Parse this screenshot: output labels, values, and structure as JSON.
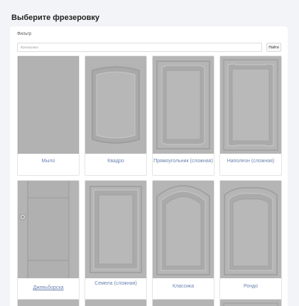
{
  "title": "Выберите фрезеровку",
  "filter": {
    "label": "Фильтр",
    "placeholder": "Фрезеровка",
    "button_label": "Найти"
  },
  "cards": [
    {
      "label": "Мыло"
    },
    {
      "label": "Квадро"
    },
    {
      "label": "Прямоугольник (сложная)"
    },
    {
      "label": "Наполеон (сложная)"
    },
    {
      "label": "Джевьборска"
    },
    {
      "label": "Семела (сложная)"
    },
    {
      "label": "Классика"
    },
    {
      "label": "Рондо"
    }
  ],
  "colors": {
    "background": "#f3f4f8",
    "card_image": "#b4b4b4",
    "label": "#6a84b0"
  }
}
